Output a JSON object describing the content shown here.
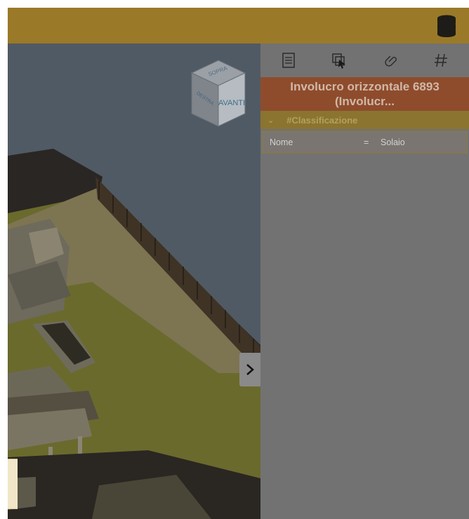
{
  "app": {
    "colors": {
      "header": "#9a7a28",
      "panel": "#727272",
      "title_bg": "#8e4c2d",
      "section_bg": "#8b7430"
    }
  },
  "header": {
    "database_icon": "database-icon"
  },
  "viewport": {
    "navcube": {
      "top_label": "SOPRA",
      "front_label": "AVANTI",
      "left_label": "DESTRA"
    }
  },
  "panel": {
    "toolbar": [
      {
        "name": "properties-list-icon"
      },
      {
        "name": "select-element-icon"
      },
      {
        "name": "link-icon"
      },
      {
        "name": "hash-icon"
      }
    ],
    "title_line1": "Involucro orizzontale 6893",
    "title_line2": "(Involucr...",
    "section": {
      "label": "#Classificazione",
      "expanded": true
    },
    "properties": [
      {
        "key": "Nome",
        "eq": "=",
        "value": "Solaio"
      }
    ]
  }
}
